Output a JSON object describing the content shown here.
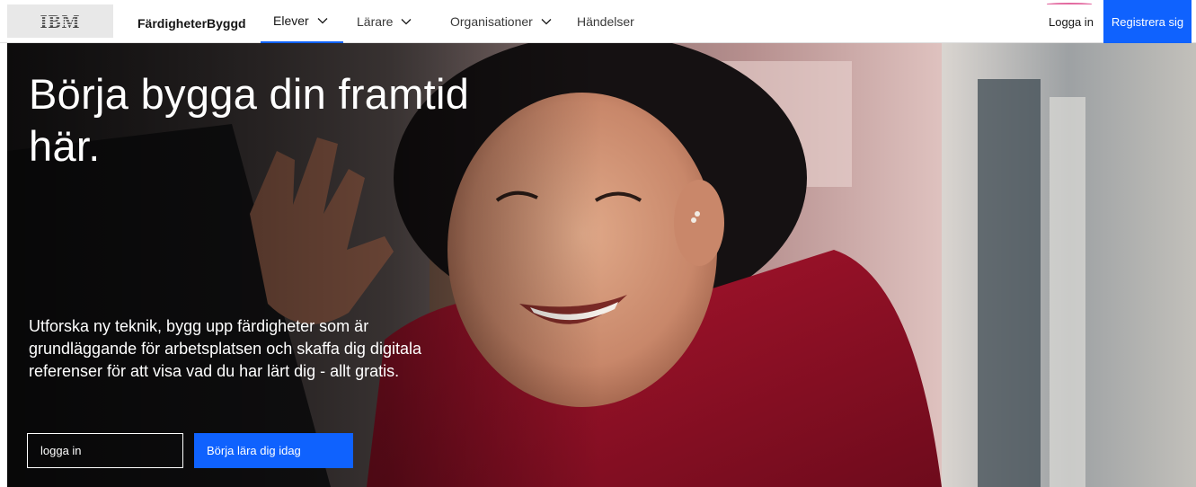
{
  "header": {
    "logo_text": "IBM",
    "brand": "FärdigheterByggd",
    "nav": [
      {
        "label": "Elever",
        "icon": "chevron-down-icon",
        "active": true
      },
      {
        "label": "Lärare",
        "icon": "chevron-down-icon"
      },
      {
        "label": "Organisationer",
        "icon": "chevron-down-icon"
      },
      {
        "label": "Händelser"
      }
    ],
    "login": "Logga in",
    "register": "Registrera sig"
  },
  "hero": {
    "headline": "Börja bygga din framtid här.",
    "lead": "Utforska ny teknik, bygg upp färdigheter som är grundläggande för arbetsplatsen och skaffa dig digitala referenser för att visa vad du har lärt dig - allt gratis.",
    "login_field_text": "logga in",
    "cta": "Börja lära dig idag"
  },
  "colors": {
    "accent": "#0f62fe",
    "hero_sweater": "#b0152f",
    "logo_text": "#4a4a4a"
  }
}
